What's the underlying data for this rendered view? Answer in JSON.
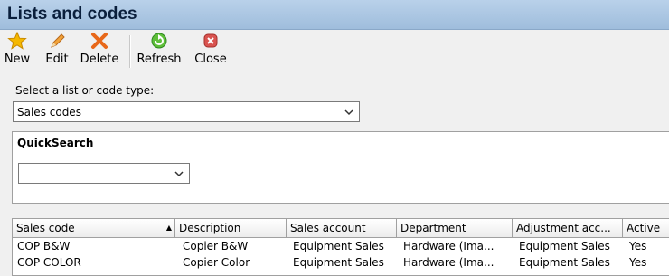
{
  "window": {
    "title": "Lists and codes"
  },
  "toolbar": {
    "new_label": "New",
    "edit_label": "Edit",
    "delete_label": "Delete",
    "refresh_label": "Refresh",
    "close_label": "Close"
  },
  "list_select": {
    "label": "Select a list or code type:",
    "value": "Sales codes"
  },
  "quicksearch": {
    "title": "QuickSearch",
    "value": ""
  },
  "grid": {
    "columns": [
      "Sales code",
      "Description",
      "Sales account",
      "Department",
      "Adjustment acc...",
      "Active"
    ],
    "sorted_column": "Sales code",
    "rows": [
      [
        "COP B&W",
        "Copier B&W",
        "Equipment Sales",
        "Hardware (Ima...",
        "Equipment Sales",
        "Yes"
      ],
      [
        "COP COLOR",
        "Copier Color",
        "Equipment Sales",
        "Hardware (Ima...",
        "Equipment Sales",
        "Yes"
      ]
    ]
  },
  "colors": {
    "titlebar": "#9fbddc",
    "title_text": "#0a1f3c"
  },
  "icons": [
    "star-icon",
    "pencil-icon",
    "delete-x-icon",
    "refresh-icon",
    "close-icon",
    "chevron-down-icon",
    "sort-up-icon"
  ]
}
